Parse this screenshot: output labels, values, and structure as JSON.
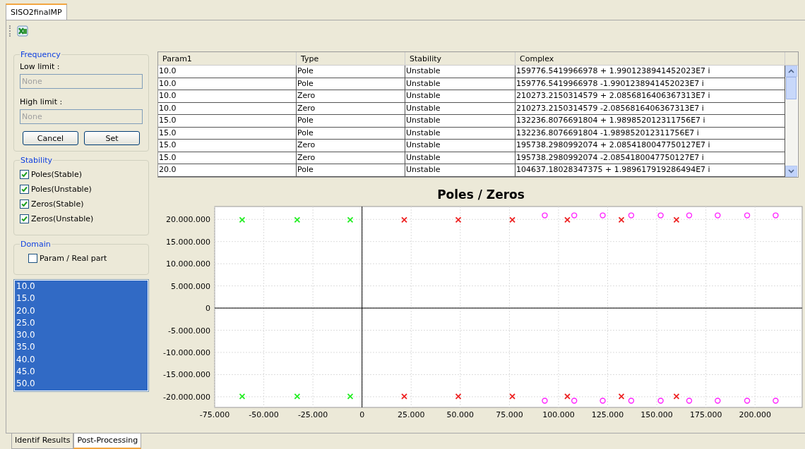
{
  "editor_tab": {
    "label": "SISO2finalMP",
    "selected": true
  },
  "frequency": {
    "title": "Frequency",
    "low_label": "Low limit :",
    "low_value": "None",
    "high_label": "High limit :",
    "high_value": "None",
    "disabled": true,
    "buttons": [
      "Cancel",
      "Set"
    ]
  },
  "stability": {
    "title": "Stability",
    "items": [
      {
        "label": "Poles(Stable)",
        "checked": true
      },
      {
        "label": "Poles(Unstable)",
        "checked": true
      },
      {
        "label": "Zeros(Stable)",
        "checked": true
      },
      {
        "label": "Zeros(Unstable)",
        "checked": true
      }
    ]
  },
  "domain": {
    "title": "Domain",
    "items": [
      {
        "label": "Param / Real part",
        "checked": false
      }
    ]
  },
  "param_list": [
    {
      "label": "10.0",
      "selected": true
    },
    {
      "label": "15.0",
      "selected": true
    },
    {
      "label": "20.0",
      "selected": true
    },
    {
      "label": "25.0",
      "selected": true
    },
    {
      "label": "30.0",
      "selected": true
    },
    {
      "label": "35.0",
      "selected": true
    },
    {
      "label": "40.0",
      "selected": true
    },
    {
      "label": "45.0",
      "selected": true
    },
    {
      "label": "50.0",
      "selected": true
    }
  ],
  "table": {
    "columns": [
      "Param1",
      "Type",
      "Stability",
      "Complex"
    ],
    "rows": [
      [
        "10.0",
        "Pole",
        "Unstable",
        "159776.5419966978 + 1.9901238941452023E7 i"
      ],
      [
        "10.0",
        "Pole",
        "Unstable",
        "159776.5419966978 -1.9901238941452023E7 i"
      ],
      [
        "10.0",
        "Zero",
        "Unstable",
        "210273.2150314579 + 2.0856816406367313E7 i"
      ],
      [
        "10.0",
        "Zero",
        "Unstable",
        "210273.2150314579 -2.0856816406367313E7 i"
      ],
      [
        "15.0",
        "Pole",
        "Unstable",
        "132236.8076691804 + 1.989852012311756E7 i"
      ],
      [
        "15.0",
        "Pole",
        "Unstable",
        "132236.8076691804 -1.989852012311756E7 i"
      ],
      [
        "15.0",
        "Zero",
        "Unstable",
        "195738.2980992074 + 2.0854180047750127E7 i"
      ],
      [
        "15.0",
        "Zero",
        "Unstable",
        "195738.2980992074 -2.0854180047750127E7 i"
      ],
      [
        "20.0",
        "Pole",
        "Unstable",
        "104637.18028347375 + 1.989617919286494E7 i"
      ]
    ]
  },
  "plot": {
    "chart_data": {
      "type": "scatter",
      "title": "Poles / Zeros",
      "grid": true,
      "xlim": [
        -75,
        224
      ],
      "ylim": [
        -22400000,
        22900000
      ],
      "xticks": [
        {
          "value": -75,
          "label": "-75.000"
        },
        {
          "value": -50,
          "label": "-50.000"
        },
        {
          "value": -25,
          "label": "-25.000"
        },
        {
          "value": 0,
          "label": "0"
        },
        {
          "value": 25,
          "label": "25.000"
        },
        {
          "value": 50,
          "label": "50.000"
        },
        {
          "value": 75,
          "label": "75.000"
        },
        {
          "value": 100,
          "label": "100.000"
        },
        {
          "value": 125,
          "label": "125.000"
        },
        {
          "value": 150,
          "label": "150.000"
        },
        {
          "value": 175,
          "label": "175.000"
        },
        {
          "value": 200,
          "label": "200.000"
        }
      ],
      "yticks": [
        {
          "value": 20000000,
          "label": "20.000.000"
        },
        {
          "value": 15000000,
          "label": "15.000.000"
        },
        {
          "value": 10000000,
          "label": "10.000.000"
        },
        {
          "value": 5000000,
          "label": "5.000.000"
        },
        {
          "value": 0,
          "label": "0"
        },
        {
          "value": -5000000,
          "label": "-5.000.000"
        },
        {
          "value": -10000000,
          "label": "-10.000.000"
        },
        {
          "value": -15000000,
          "label": "-15.000.000"
        },
        {
          "value": -20000000,
          "label": "-20.000.000"
        }
      ],
      "series": [
        {
          "color": "#22ee22",
          "x": [
            -61,
            -33,
            -6,
            -61,
            -33,
            -6
          ],
          "values": [
            19900000,
            19900000,
            19900000,
            -19900000,
            -19900000,
            -19900000
          ]
        },
        {
          "color": "#ee2222",
          "x": [
            21.5,
            49,
            76.5,
            104.5,
            132,
            160,
            21.5,
            49,
            76.5,
            104.5,
            132,
            160
          ],
          "values": [
            19900000,
            19900000,
            19900000,
            19900000,
            19900000,
            19900000,
            -19900000,
            -19900000,
            -19900000,
            -19900000,
            -19900000,
            -19900000
          ]
        },
        {
          "color": "#ff22ff",
          "x": [
            93,
            108,
            122.5,
            137,
            152,
            166.5,
            181,
            196,
            210.5,
            93,
            108,
            122.5,
            137,
            152,
            166.5,
            181,
            196,
            210.5
          ],
          "values": [
            20900000,
            20900000,
            20900000,
            20900000,
            20900000,
            20900000,
            20900000,
            20900000,
            20900000,
            -20900000,
            -20900000,
            -20900000,
            -20900000,
            -20900000,
            -20900000,
            -20900000,
            -20900000,
            -20900000
          ]
        }
      ]
    }
  },
  "bottom_tabs": [
    {
      "label": "Identif Results",
      "selected": false
    },
    {
      "label": "Post-Processing",
      "selected": true
    }
  ]
}
